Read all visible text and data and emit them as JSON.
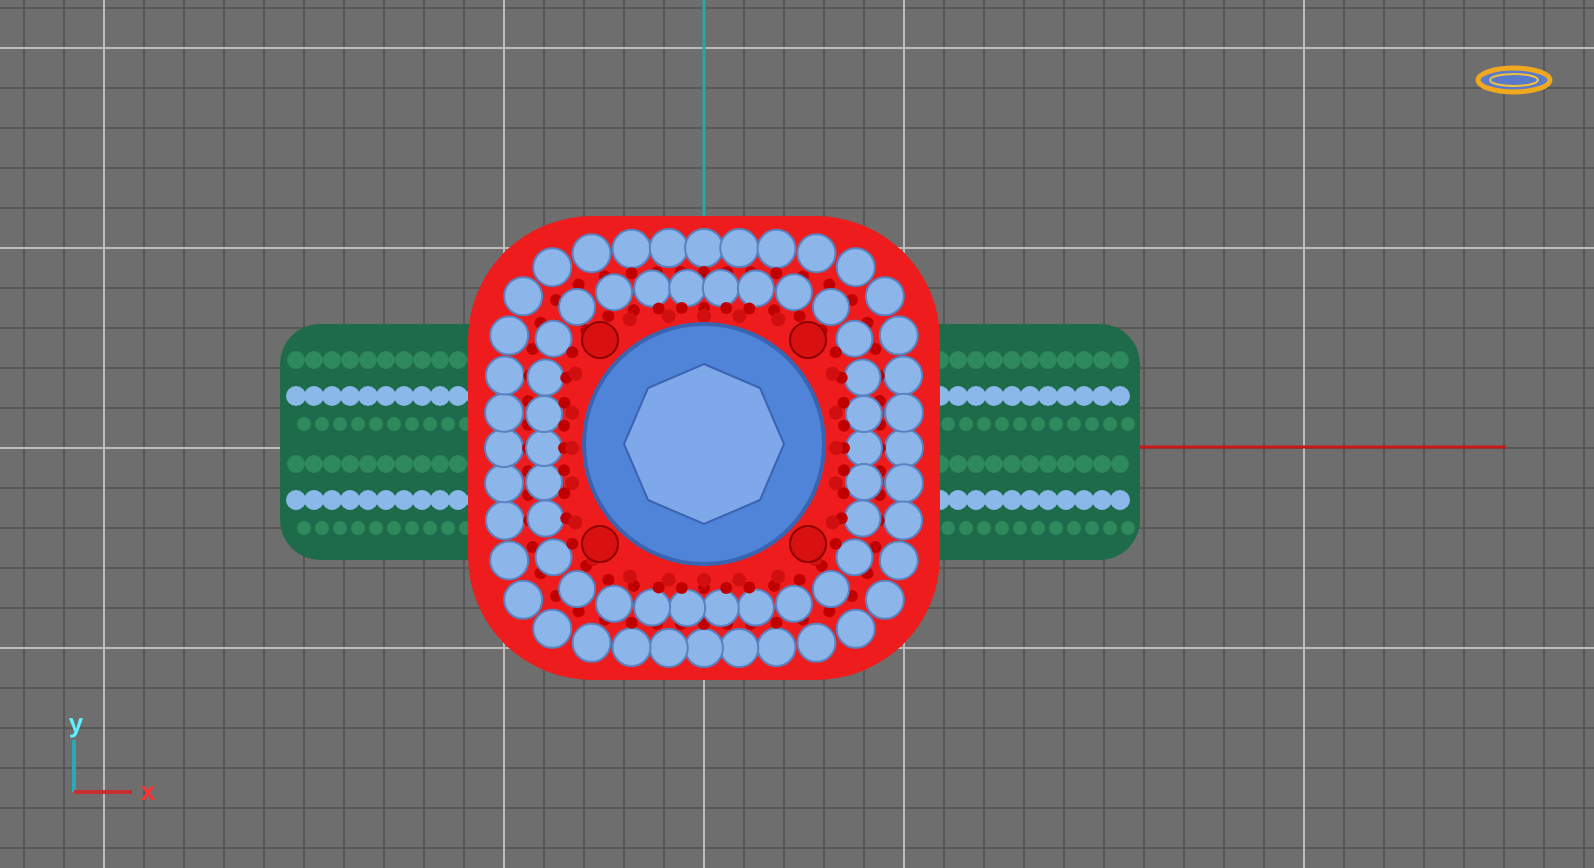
{
  "viewport": {
    "axis_widget": {
      "y_label": "y",
      "x_label": "x"
    }
  }
}
